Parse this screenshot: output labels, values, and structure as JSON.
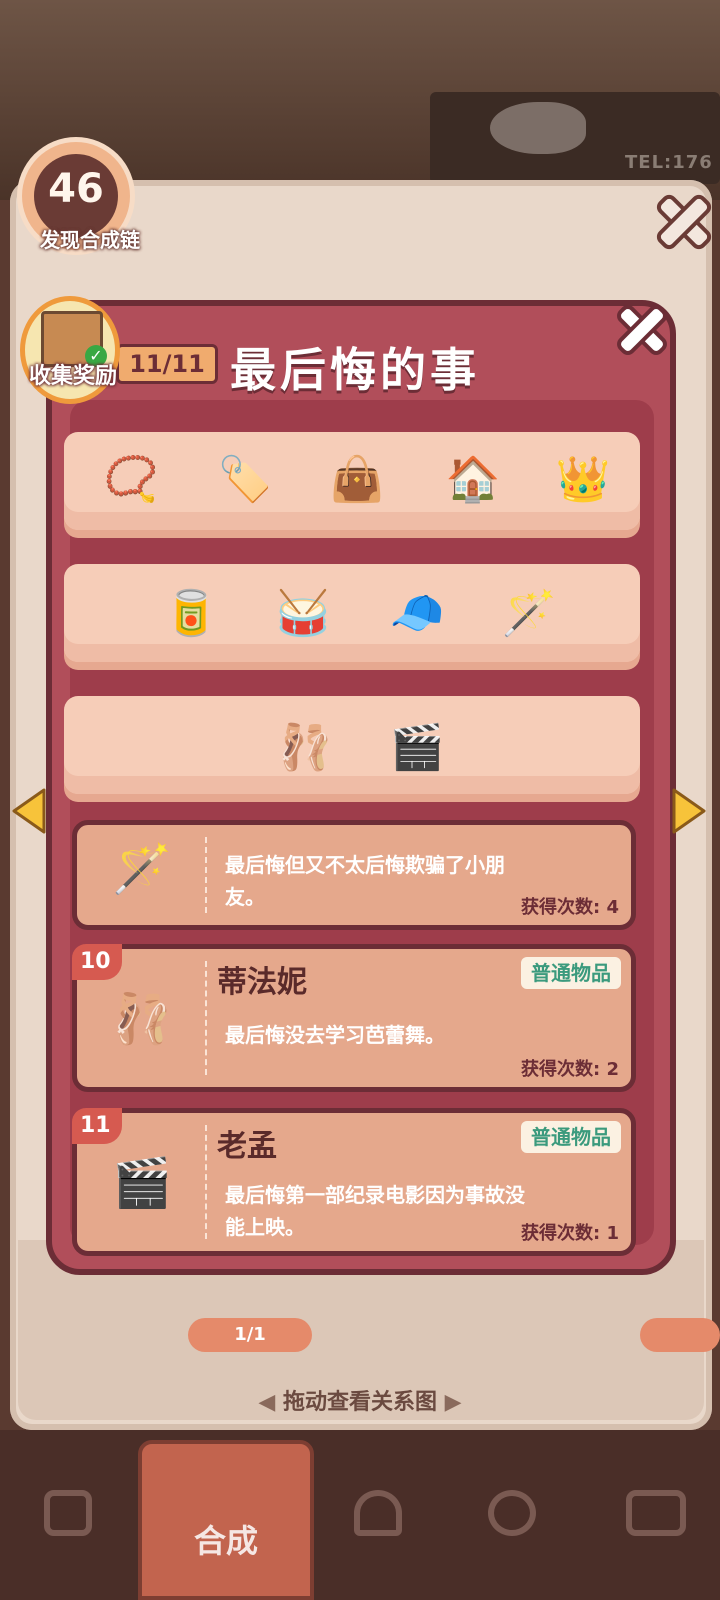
{
  "background": {
    "tel": "TEL:176"
  },
  "chain_badge": {
    "count": "46",
    "label": "发现合成链"
  },
  "collect_reward": {
    "label": "收集奖励"
  },
  "collection": {
    "progress": "11/11",
    "title": "最后悔的事"
  },
  "shelf_items": [
    [
      "prayer-beads-icon",
      "tag-charm-icon",
      "blue-bag-icon",
      "house-icon",
      "crown-icon"
    ],
    [
      "tin-can-icon",
      "drum-icon",
      "cap-icon",
      "magic-wand-icon"
    ],
    [
      "ballet-shoes-icon",
      "clapperboard-icon"
    ]
  ],
  "cards": [
    {
      "desc": "最后悔但又不太后悔欺骗了小朋友。",
      "obtain_label": "获得次数: 4"
    },
    {
      "index": "10",
      "name": "蒂法妮",
      "type": "普通物品",
      "desc": "最后悔没去学习芭蕾舞。",
      "obtain_label": "获得次数: 2"
    },
    {
      "index": "11",
      "name": "老孟",
      "type": "普通物品",
      "desc": "最后悔第一部纪录电影因为事故没能上映。",
      "obtain_label": "获得次数: 1"
    }
  ],
  "pager": {
    "label": "1/1"
  },
  "hint": {
    "text": "拖动查看关系图"
  },
  "nav": {
    "center_label": "合成"
  },
  "colors": {
    "modal": "#b14e5a",
    "modal_border": "#6c2d36",
    "card": "#e5a88c",
    "shelf": "#f6cdb8",
    "type_text": "#3b9a7d"
  }
}
